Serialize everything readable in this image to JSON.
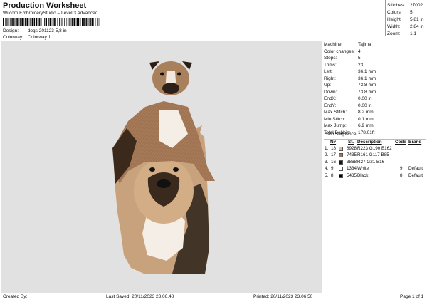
{
  "header": {
    "title": "Production Worksheet",
    "subtitle": "Wilcom EmbroideryStudio – Level 3 Advanced"
  },
  "meta": {
    "design_label": "Design:",
    "design_value": "dogs 201123 5,8 in",
    "colorway_label": "Colorway:",
    "colorway_value": "Colorway 1"
  },
  "top_stats": [
    {
      "label": "Stitches:",
      "value": "27002"
    },
    {
      "label": "Colors:",
      "value": "5"
    },
    {
      "label": "Height:",
      "value": "5.81 in"
    },
    {
      "label": "Width:",
      "value": "2.84 in"
    },
    {
      "label": "Zoom:",
      "value": "1:1"
    }
  ],
  "machine_info": [
    {
      "label": "Machine:",
      "value": "Tajima"
    },
    {
      "label": "Color changes:",
      "value": "4"
    },
    {
      "label": "Stops:",
      "value": "5"
    },
    {
      "label": "Trims:",
      "value": "23"
    },
    {
      "label": "Left:",
      "value": "36.1 mm"
    },
    {
      "label": "Right:",
      "value": "36.1 mm"
    },
    {
      "label": "Up:",
      "value": "73.8 mm"
    },
    {
      "label": "Down:",
      "value": "73.8 mm"
    },
    {
      "label": "EndX:",
      "value": "0.00 in"
    },
    {
      "label": "EndY:",
      "value": "0.00 in"
    },
    {
      "label": "Max Stitch:",
      "value": "8.2 mm"
    },
    {
      "label": "Min Stitch:",
      "value": "0.1 mm"
    },
    {
      "label": "Max Jump:",
      "value": "6.9 mm"
    },
    {
      "label": "Total Bobbin:",
      "value": "178.01ft"
    }
  ],
  "stop_sequence": {
    "title": "Stop Sequence:",
    "headers": {
      "num": "N#",
      "st": "St.",
      "desc": "Description",
      "code": "Code",
      "brand": "Brand"
    },
    "rows": [
      {
        "idx": "1.",
        "num": "18",
        "st": "8928",
        "desc": "R223 G190 B162",
        "code": "",
        "brand": "",
        "color": "#dfbea2"
      },
      {
        "idx": "2.",
        "num": "17",
        "st": "7435",
        "desc": "R161 G117 B85",
        "code": "",
        "brand": "",
        "color": "#a17555"
      },
      {
        "idx": "3.",
        "num": "16",
        "st": "3868",
        "desc": "R27 G21 B16",
        "code": "",
        "brand": "",
        "color": "#1b1510"
      },
      {
        "idx": "4.",
        "num": "9",
        "st": "1334",
        "desc": "White",
        "code": "9",
        "brand": "Default",
        "color": "#ffffff"
      },
      {
        "idx": "5.",
        "num": "8",
        "st": "5435",
        "desc": "Black",
        "code": "8",
        "brand": "Default",
        "color": "#000000"
      }
    ]
  },
  "footer": {
    "created_by": "Created By:",
    "last_saved": "Last Saved: 20/11/2023 23.06.48",
    "printed": "Printed: 20/11/2023 23.06.50",
    "page": "Page 1 of 1"
  }
}
